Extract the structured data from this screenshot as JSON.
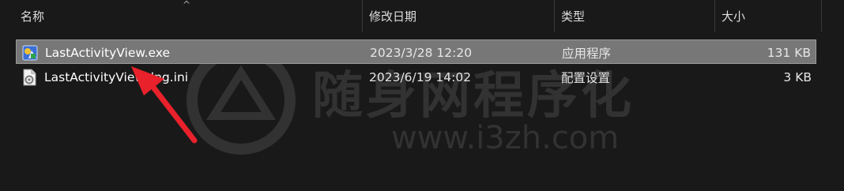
{
  "columns": {
    "name": "名称",
    "date": "修改日期",
    "type": "类型",
    "size": "大小"
  },
  "sort_indicator": "^",
  "files": [
    {
      "name": "LastActivityView.exe",
      "date": "2023/3/28 12:20",
      "type": "应用程序",
      "size": "131 KB",
      "icon": "exe-app-icon",
      "selected": true
    },
    {
      "name": "LastActivityView_lng.ini",
      "date": "2023/6/19 14:02",
      "type": "配置设置",
      "size": "3 KB",
      "icon": "ini-settings-file-icon",
      "selected": false
    }
  ],
  "watermark": {
    "main": "随身网程序化",
    "url": "www.i3zh.com"
  },
  "annotation_color": "#e8212b"
}
